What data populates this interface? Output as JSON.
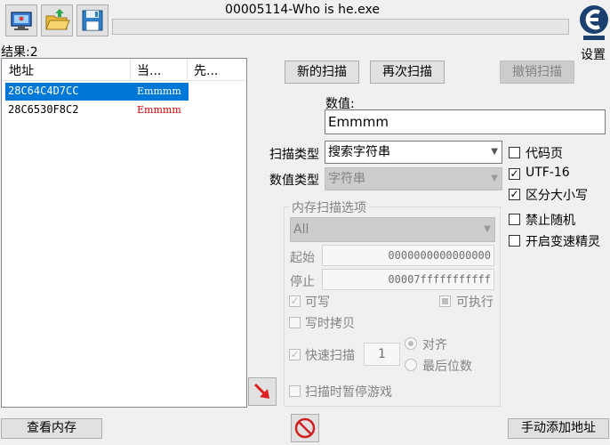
{
  "window": {
    "title": "00005114-Who is he.exe"
  },
  "toolbar": {
    "open_process_icon": "monitor-icon",
    "open_file_icon": "folder-open-icon",
    "save_icon": "floppy-disk-icon"
  },
  "settings": {
    "label": "设置",
    "logo_icon": "cheat-engine-logo"
  },
  "results": {
    "label": "结果:2",
    "columns": [
      "地址",
      "当...",
      "先..."
    ],
    "rows": [
      {
        "address": "28C64C4D7CC",
        "value": "Emmmm",
        "selected": true
      },
      {
        "address": "28C6530F8C2",
        "value": "Emmmm",
        "selected": false
      }
    ]
  },
  "scan": {
    "new_scan": "新的扫描",
    "next_scan": "再次扫描",
    "undo_scan": "撤销扫描",
    "value_label": "数值:",
    "value": "Emmmm",
    "scan_type_label": "扫描类型",
    "scan_type": "搜索字符串",
    "value_type_label": "数值类型",
    "value_type": "字符串"
  },
  "string_options": {
    "codepage": {
      "label": "代码页",
      "checked": false
    },
    "utf16": {
      "label": "UTF-16",
      "checked": true
    },
    "case_sensitive": {
      "label": "区分大小写",
      "checked": true
    },
    "no_random": {
      "label": "禁止随机",
      "checked": false
    },
    "speedhack": {
      "label": "开启变速精灵",
      "checked": false
    }
  },
  "memory_options": {
    "title": "内存扫描选项",
    "region": "All",
    "start_label": "起始",
    "start": "0000000000000000",
    "stop_label": "停止",
    "stop": "00007fffffffffff",
    "writable": {
      "label": "可写",
      "checked": true
    },
    "executable": {
      "label": "可执行",
      "checked": "indeterminate"
    },
    "copy_on_write": {
      "label": "写时拷贝",
      "checked": false
    },
    "fast_scan": {
      "label": "快速扫描",
      "checked": true,
      "value": "1"
    },
    "alignment": {
      "label": "对齐",
      "selected": true
    },
    "last_digits": {
      "label": "最后位数",
      "selected": false
    },
    "pause_game": {
      "label": "扫描时暂停游戏",
      "checked": false
    }
  },
  "bottom": {
    "view_memory": "查看内存",
    "add_address": "手动添加地址",
    "stop_icon": "no-entry-icon",
    "arrow_icon": "add-to-list-arrow-icon"
  },
  "colors": {
    "selection": "#0078d7",
    "value_red": "#e00000",
    "arrow_red": "#e02020"
  }
}
